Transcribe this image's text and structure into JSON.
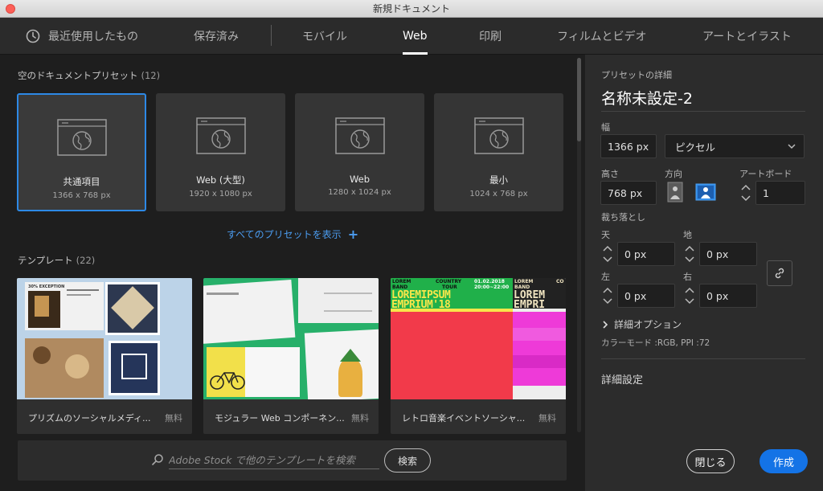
{
  "window": {
    "title": "新規ドキュメント"
  },
  "tabs": [
    {
      "label": "最近使用したもの"
    },
    {
      "label": "保存済み"
    },
    {
      "label": "モバイル"
    },
    {
      "label": "Web"
    },
    {
      "label": "印刷"
    },
    {
      "label": "フィルムとビデオ"
    },
    {
      "label": "アートとイラスト"
    }
  ],
  "active_tab": "Web",
  "blank_presets": {
    "title": "空のドキュメントプリセット",
    "count": "(12)",
    "items": [
      {
        "name": "共通項目",
        "size": "1366 x 768 px",
        "selected": true
      },
      {
        "name": "Web (大型)",
        "size": "1920 x 1080 px"
      },
      {
        "name": "Web",
        "size": "1280 x 1024 px"
      },
      {
        "name": "最小",
        "size": "1024 x 768 px"
      }
    ],
    "show_all": "すべてのプリセットを表示",
    "show_all_icon": "+"
  },
  "templates": {
    "title": "テンプレート",
    "count": "(22)",
    "items": [
      {
        "name": "プリズムのソーシャルメディ...",
        "price": "無料"
      },
      {
        "name": "モジュラー Web コンポーネン...",
        "price": "無料"
      },
      {
        "name": "レトロ音楽イベントソーシャ...",
        "price": "無料"
      }
    ]
  },
  "thumb_text": {
    "t1_tag": "30% EXCEPTION",
    "t3_left_line1": "LOREM",
    "t3_left_line2": "BAND",
    "t3_mid_line1": "COUNTRY",
    "t3_mid_line2": "TOUR",
    "t3_date_line1": "01.02.2018",
    "t3_date_line2": "20:00~22:00",
    "t3_big1": "LOREMIPSUM",
    "t3_big2": "EMPRIUM'18",
    "t3_r_line1": "LOREM",
    "t3_r_line2": "BAND",
    "t3_r_cut": "CO",
    "t3_r_big1": "LOREM",
    "t3_r_big2": "EMPRI"
  },
  "search": {
    "placeholder": "Adobe Stock で他のテンプレートを検索",
    "button": "検索"
  },
  "details": {
    "header": "プリセットの詳細",
    "name": "名称未設定-2",
    "width_label": "幅",
    "width_value": "1366 px",
    "unit": "ピクセル",
    "height_label": "高さ",
    "height_value": "768 px",
    "orientation_label": "方向",
    "artboard_label": "アートボード",
    "artboard_value": "1",
    "bleed_label": "裁ち落とし",
    "top_label": "天",
    "top_value": "0 px",
    "bottom_label": "地",
    "bottom_value": "0 px",
    "left_label": "左",
    "left_value": "0 px",
    "right_label": "右",
    "right_value": "0 px",
    "advanced_options": "詳細オプション",
    "color_mode": "カラーモード :RGB, PPI :72",
    "advanced_settings": "詳細設定"
  },
  "buttons": {
    "close": "閉じる",
    "create": "作成"
  },
  "colors": {
    "accent": "#1473e6",
    "link": "#4b9cf0",
    "selected_border": "#2d89e6"
  }
}
